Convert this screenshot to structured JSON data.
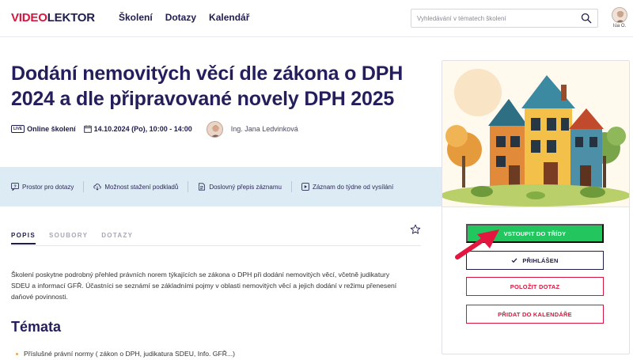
{
  "header": {
    "logo_part1": "VIDEO",
    "logo_part2": "LEKTOR",
    "nav": [
      "Školení",
      "Dotazy",
      "Kalendář"
    ],
    "search_placeholder": "Vyhledávání v tématech školení",
    "user_name": "Iúa O."
  },
  "course": {
    "title": "Dodání nemovitých věcí dle zákona o DPH 2024 a dle připravované novely DPH 2025",
    "live_tag": "LIVE",
    "type": "Online školení",
    "datetime": "14.10.2024 (Po), 10:00 - 14:00",
    "lector": "Ing. Jana Ledvinková"
  },
  "features": [
    {
      "icon": "question-icon",
      "label": "Prostor pro dotazy"
    },
    {
      "icon": "cloud-download-icon",
      "label": "Možnost stažení podkladů"
    },
    {
      "icon": "transcript-icon",
      "label": "Doslovný přepis záznamu"
    },
    {
      "icon": "play-icon",
      "label": "Záznam do týdne od vysílání"
    }
  ],
  "tabs": [
    "POPIS",
    "SOUBORY",
    "DOTAZY"
  ],
  "description": "Školení poskytne podrobný přehled právních norem týkajících se zákona o DPH při dodání nemovitých věcí, včetně judikatury SDEU a informací GFŘ. Účastníci se seznámí se základními pojmy v oblasti nemovitých věcí a jejich dodání v režimu přenesení daňové povinnosti.",
  "topics_heading": "Témata",
  "topics": [
    "Příslušné právní normy ( zákon o DPH, judikatura SDEU, Info. GFŘ...)"
  ],
  "actions": {
    "enter": "VSTOUPIT DO TŘÍDY",
    "registered": "PŘIHLÁŠEN",
    "ask": "POLOŽIT DOTAZ",
    "calendar": "PŘIDAT DO KALENDÁŘE"
  },
  "colors": {
    "brand_red": "#d8163d",
    "navy": "#1f1d4e",
    "green": "#23c55e",
    "band": "#ddebf5"
  }
}
